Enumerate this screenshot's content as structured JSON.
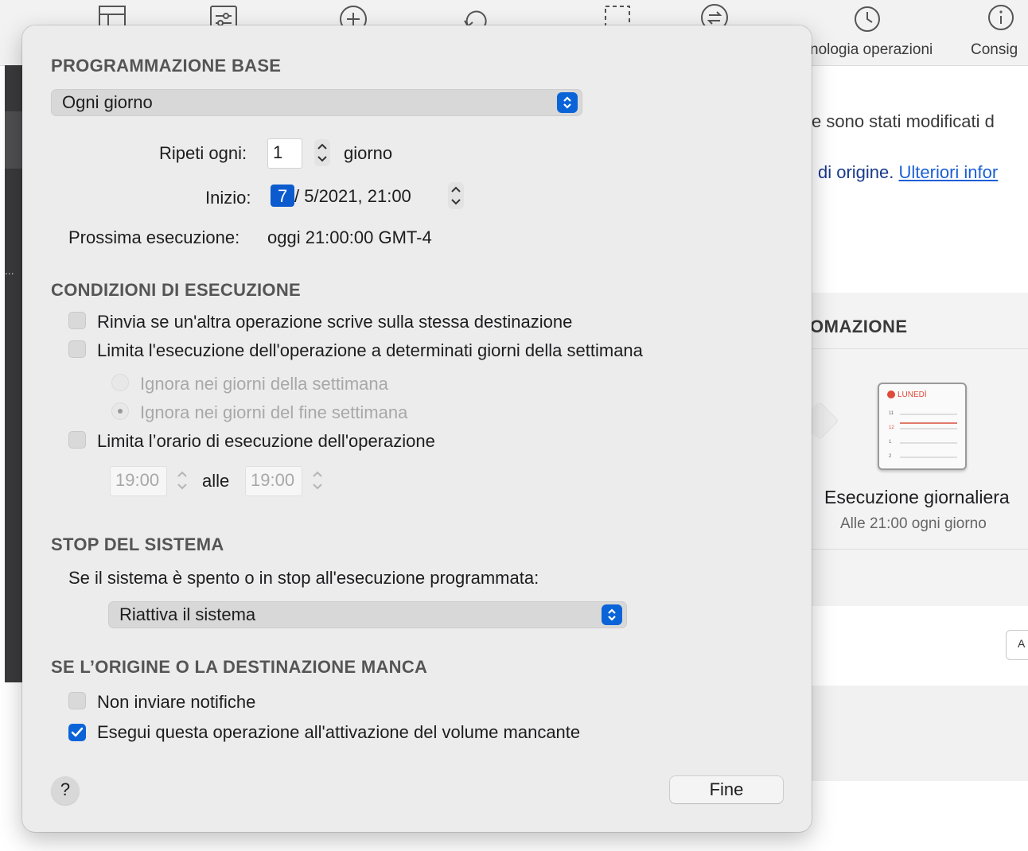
{
  "background": {
    "toolbar_labels": [
      "nologia operazioni",
      "Consig"
    ],
    "text_modified": "e sono stati modificati d",
    "text_origin": "di origine.",
    "text_link": "Ulteriori infor",
    "section_title": "OMAZIONE",
    "calendar_day": "LUNEDÌ",
    "calendar_numbers": [
      "11",
      "12",
      "1",
      "2"
    ],
    "schedule_title": "Esecuzione giornaliera",
    "schedule_subtitle": "Alle 21:00 ogni giorno",
    "partial_button": "A"
  },
  "basic": {
    "title": "PROGRAMMAZIONE BASE",
    "frequency": "Ogni giorno",
    "repeat_label": "Ripeti ogni:",
    "repeat_value": "1",
    "repeat_unit": "giorno",
    "start_label": "Inizio:",
    "start_day": "7",
    "start_rest": "/  5/2021, 21:00",
    "next_run_label": "Prossima esecuzione:",
    "next_run_value": "oggi 21:00:00 GMT-4"
  },
  "conditions": {
    "title": "CONDIZIONI DI ESECUZIONE",
    "defer": "Rinvia se un'altra operazione scrive sulla stessa destinazione",
    "limit_days": "Limita l'esecuzione dell'operazione a determinati giorni della settimana",
    "ignore_weekdays": "Ignora nei giorni della settimana",
    "ignore_weekend": "Ignora nei giorni del fine settimana",
    "limit_time": "Limita l’orario di esecuzione dell'operazione",
    "time_from": "19:00",
    "time_sep": "alle",
    "time_to": "19:00"
  },
  "sleep": {
    "title": "STOP DEL SISTEMA",
    "description": "Se il sistema è spento o in stop all'esecuzione programmata:",
    "action": "Riattiva il sistema"
  },
  "missing": {
    "title": "SE L’ORIGINE O LA DESTINAZIONE MANCA",
    "no_notify": "Non inviare notifiche",
    "run_on_mount": "Esegui questa operazione all'attivazione del volume mancante",
    "run_on_mount_checked": true
  },
  "footer": {
    "help": "?",
    "done": "Fine"
  }
}
